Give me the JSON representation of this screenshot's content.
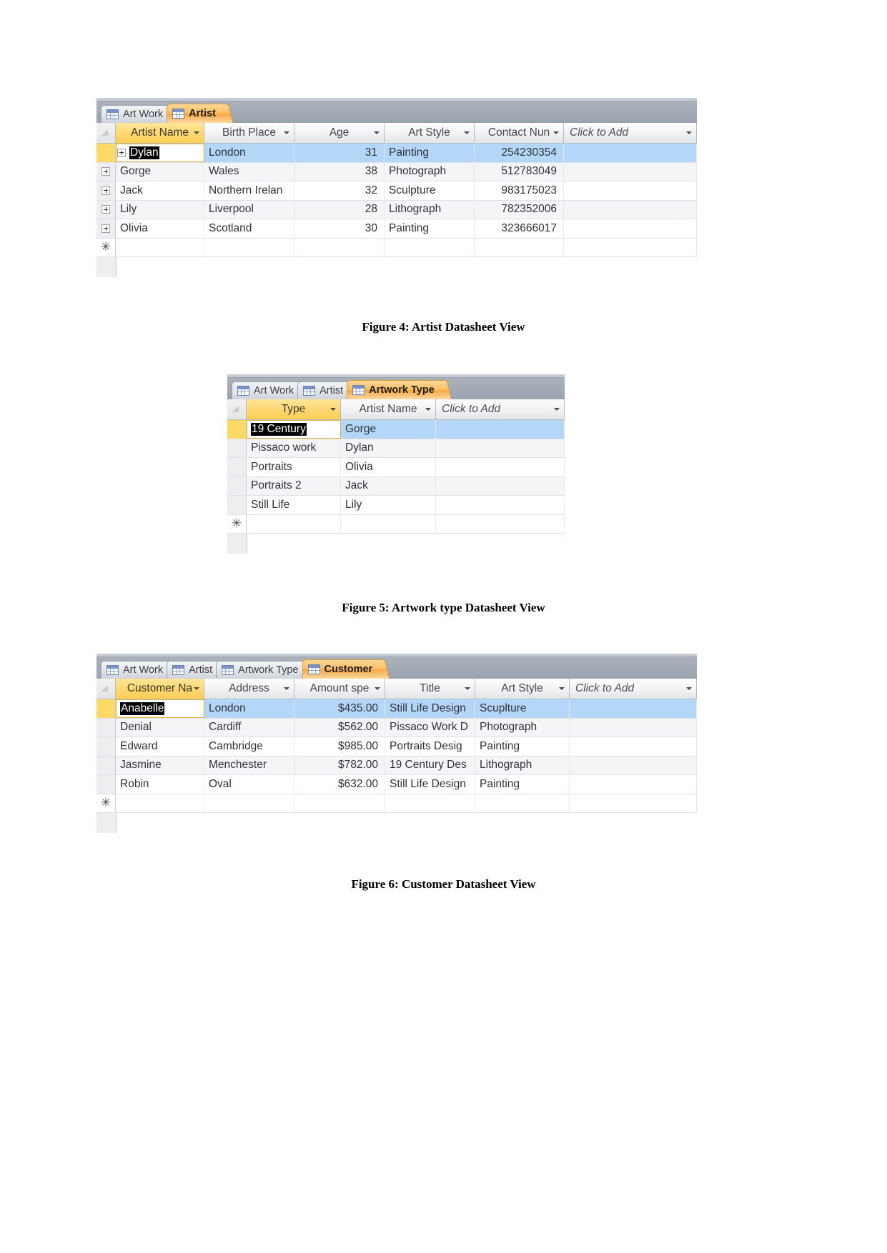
{
  "figures": [
    {
      "id": "artist",
      "caption": "Figure 4: Artist Datasheet View",
      "tabs": [
        {
          "label": "Art Work",
          "active": false
        },
        {
          "label": "Artist",
          "active": true
        }
      ],
      "columns": [
        {
          "label": "Artist Name",
          "selected": true
        },
        {
          "label": "Birth Place",
          "selected": false
        },
        {
          "label": "Age",
          "selected": false
        },
        {
          "label": "Art Style",
          "selected": false
        },
        {
          "label": "Contact Nun",
          "selected": false
        },
        {
          "label": "Click to Add",
          "selected": false
        }
      ],
      "rows": [
        {
          "cells": [
            "Dylan",
            "London",
            "31",
            "Painting",
            "254230354",
            ""
          ]
        },
        {
          "cells": [
            "Gorge",
            "Wales",
            "38",
            "Photograph",
            "512783049",
            ""
          ]
        },
        {
          "cells": [
            "Jack",
            "Northern Irelan",
            "32",
            "Sculpture",
            "983175023",
            ""
          ]
        },
        {
          "cells": [
            "Lily",
            "Liverpool",
            "28",
            "Lithograph",
            "782352006",
            ""
          ]
        },
        {
          "cells": [
            "Olivia",
            "Scotland",
            "30",
            "Painting",
            "323666017",
            ""
          ]
        }
      ],
      "new_row_marker": "✳"
    },
    {
      "id": "artwork-type",
      "caption": "Figure 5: Artwork type Datasheet View",
      "tabs": [
        {
          "label": "Art Work",
          "active": false
        },
        {
          "label": "Artist",
          "active": false
        },
        {
          "label": "Artwork Type",
          "active": true
        }
      ],
      "columns": [
        {
          "label": "Type",
          "selected": true
        },
        {
          "label": "Artist Name",
          "selected": false
        },
        {
          "label": "Click to Add",
          "selected": false
        }
      ],
      "rows": [
        {
          "cells": [
            "19 Century",
            "Gorge",
            ""
          ]
        },
        {
          "cells": [
            "Pissaco work",
            "Dylan",
            ""
          ]
        },
        {
          "cells": [
            "Portraits",
            "Olivia",
            ""
          ]
        },
        {
          "cells": [
            "Portraits 2",
            "Jack",
            ""
          ]
        },
        {
          "cells": [
            "Still Life",
            "Lily",
            ""
          ]
        }
      ],
      "new_row_marker": "✳"
    },
    {
      "id": "customer",
      "caption": "Figure 6: Customer Datasheet View",
      "tabs": [
        {
          "label": "Art Work",
          "active": false
        },
        {
          "label": "Artist",
          "active": false
        },
        {
          "label": "Artwork Type",
          "active": false
        },
        {
          "label": "Customer",
          "active": true
        }
      ],
      "columns": [
        {
          "label": "Customer Na",
          "selected": true
        },
        {
          "label": "Address",
          "selected": false
        },
        {
          "label": "Amount spe",
          "selected": false
        },
        {
          "label": "Title",
          "selected": false
        },
        {
          "label": "Art Style",
          "selected": false
        },
        {
          "label": "Click to Add",
          "selected": false
        }
      ],
      "rows": [
        {
          "cells": [
            "Anabelle",
            "London",
            "$435.00",
            "Still Life Design",
            "Scuplture",
            ""
          ]
        },
        {
          "cells": [
            "Denial",
            "Cardiff",
            "$562.00",
            "Pissaco Work D",
            "Photograph",
            ""
          ]
        },
        {
          "cells": [
            "Edward",
            "Cambridge",
            "$985.00",
            "Portraits Desig",
            "Painting",
            ""
          ]
        },
        {
          "cells": [
            "Jasmine",
            "Menchester",
            "$782.00",
            "19 Century Des",
            "Lithograph",
            ""
          ]
        },
        {
          "cells": [
            "Robin",
            "Oval",
            "$632.00",
            "Still Life Design",
            "Painting",
            ""
          ]
        }
      ],
      "new_row_marker": "✳"
    }
  ],
  "colors": {
    "accent_orange": "#f9a73e",
    "selected_header": "#ffd873",
    "selected_row": "#b4d6f7",
    "tabstrip": "#a3abb5"
  }
}
